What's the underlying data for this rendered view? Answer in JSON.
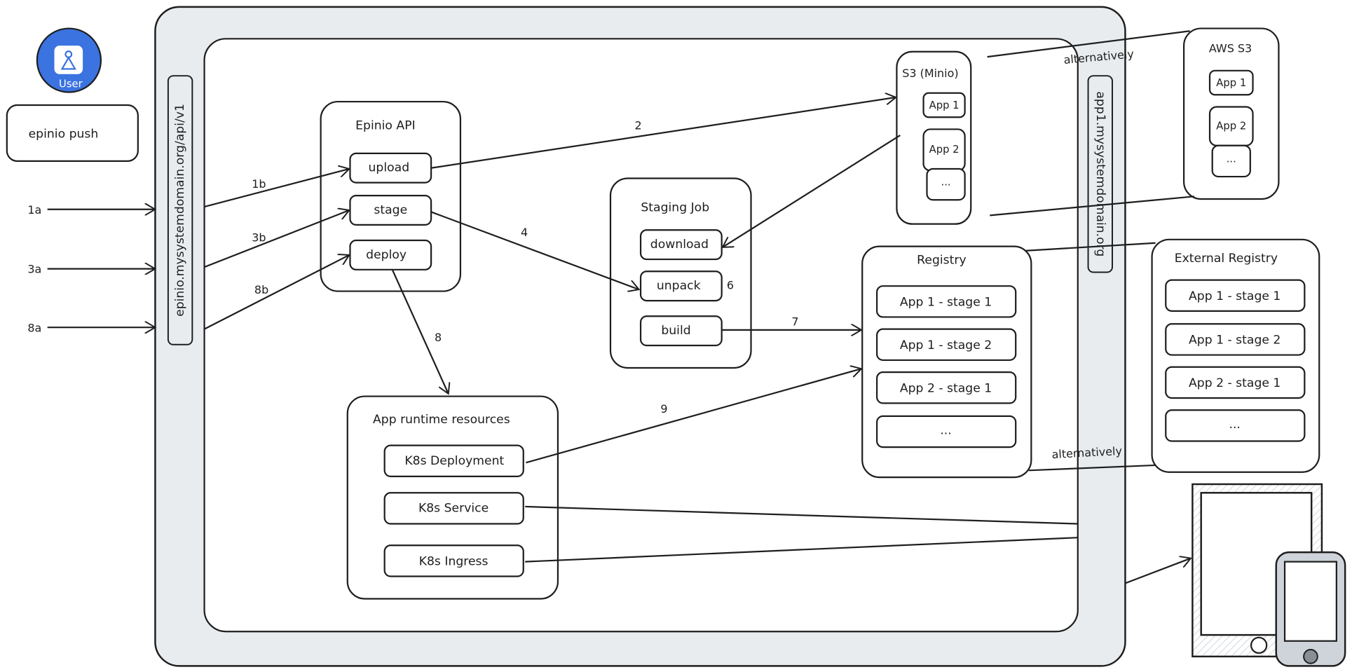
{
  "colors": {
    "frame": "#e9ecef",
    "user": "#3b73e0",
    "stroke": "#1e1e1e",
    "phone": "#ced4da",
    "phone_button": "#868e96"
  },
  "user": {
    "label": "User",
    "icon": "user-icon"
  },
  "cli": {
    "command": "epinio push"
  },
  "api_url": "epinio.mysystemdomain.org/api/v1",
  "app_url": "app1.mysystemdomain.org",
  "incoming": [
    "1a",
    "3a",
    "8a"
  ],
  "epinio_api": {
    "title": "Epinio API",
    "endpoints": [
      "upload",
      "stage",
      "deploy"
    ]
  },
  "staging_job": {
    "title": "Staging Job",
    "steps": [
      "download",
      "unpack",
      "build"
    ]
  },
  "s3_minio": {
    "title": "S3 (Minio)",
    "items": [
      "App 1",
      "App 2",
      "..."
    ]
  },
  "aws_s3": {
    "title": "AWS S3",
    "items": [
      "App 1",
      "App 2",
      "..."
    ]
  },
  "registry": {
    "title": "Registry",
    "items": [
      "App 1 - stage 1",
      "App 1 - stage 2",
      "App 2 - stage 1",
      "..."
    ]
  },
  "external_registry": {
    "title": "External Registry",
    "items": [
      "App 1 - stage 1",
      "App 1 - stage 2",
      "App 2 - stage 1",
      "..."
    ]
  },
  "runtime": {
    "title": "App runtime resources",
    "items": [
      "K8s Deployment",
      "K8s Service",
      "K8s Ingress"
    ]
  },
  "edges": {
    "e1b": "1b",
    "e3b": "3b",
    "e8b": "8b",
    "e2": "2",
    "e4": "4",
    "e6": "6",
    "e7": "7",
    "e8": "8",
    "e9": "9"
  },
  "alternatively": "alternatively"
}
